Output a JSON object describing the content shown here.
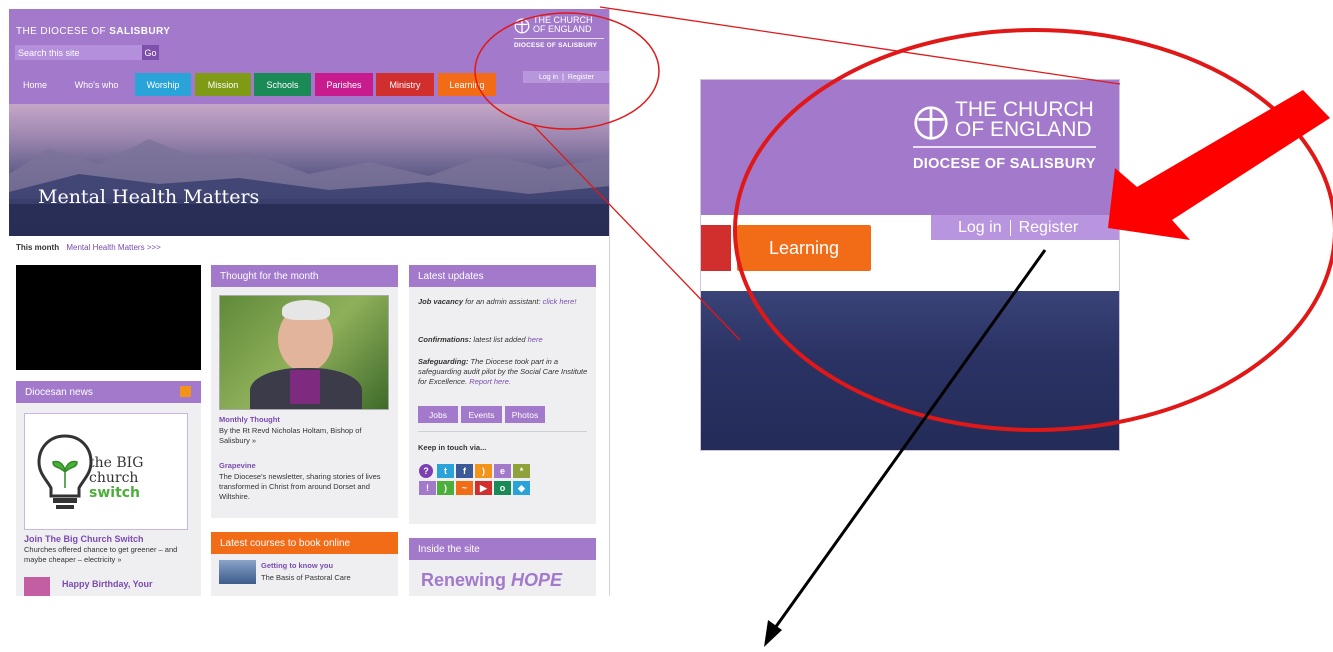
{
  "site": {
    "header": {
      "diocese_prefix": "THE DIOCESE OF",
      "diocese_name": "SALISBURY",
      "search_placeholder": "Search this site",
      "go_label": "Go",
      "logo_line1": "THE CHURCH",
      "logo_line2": "OF ENGLAND",
      "logo_line3": "DIOCESE OF SALISBURY",
      "login_label": "Log in",
      "register_label": "Register"
    },
    "nav": [
      {
        "label": "Home",
        "color": "#a279cb"
      },
      {
        "label": "Who's who",
        "color": "#a279cb"
      },
      {
        "label": "Worship",
        "color": "#2aa3d8"
      },
      {
        "label": "Mission",
        "color": "#7f9a14"
      },
      {
        "label": "Schools",
        "color": "#1a8a57"
      },
      {
        "label": "Parishes",
        "color": "#c81c8e"
      },
      {
        "label": "Ministry",
        "color": "#d12e2e"
      },
      {
        "label": "Learning",
        "color": "#f26c18"
      }
    ],
    "hero_title": "Mental Health Matters",
    "this_month_label": "This month",
    "this_month_link": "Mental Health Matters >>>",
    "diocesan_news": {
      "heading": "Diocesan news",
      "promo_line1": "the BIG",
      "promo_line2": "church",
      "promo_line3": "switch",
      "item1_title": "Join The Big Church Switch",
      "item1_text": "Churches offered chance to get greener – and maybe cheaper – electricity »",
      "item2_title": "Happy Birthday, Your"
    },
    "thought": {
      "heading": "Thought for the month",
      "monthly_title": "Monthly Thought",
      "monthly_text": "By the Rt Revd Nicholas Holtam, Bishop of Salisbury »",
      "grapevine_title": "Grapevine",
      "grapevine_text": "The Diocese's newsletter, sharing stories of lives transformed in Christ from around Dorset and Wiltshire."
    },
    "courses": {
      "heading": "Latest courses to book online",
      "course_title": "Getting to know you",
      "course_text": "The Basis of Pastoral Care"
    },
    "updates": {
      "heading": "Latest updates",
      "u1_bold": "Job vacancy",
      "u1_text": " for an admin assistant: ",
      "u1_link": "click here!",
      "u2_bold": "Confirmations:",
      "u2_text": " latest list added ",
      "u2_link": "here",
      "u3_bold": "Safeguarding:",
      "u3_text": " The Diocese took part in a safeguarding audit pilot by the Social Care Institute for Excellence. ",
      "u3_link": "Report here.",
      "btn_jobs": "Jobs",
      "btn_events": "Events",
      "btn_photos": "Photos",
      "keep_in_touch": "Keep in touch via..."
    },
    "inside": {
      "heading": "Inside the site",
      "renewing": "Renewing ",
      "hope": "HOPE"
    }
  },
  "zoom": {
    "logo_line1": "THE CHURCH",
    "logo_line2": "OF ENGLAND",
    "logo_line3": "DIOCESE OF SALISBURY",
    "login_label": "Log in",
    "register_label": "Register",
    "learning_label": "Learning"
  },
  "colors": {
    "brand_purple": "#a279cb",
    "annotation_red": "#e01818",
    "annotation_black": "#000000"
  }
}
